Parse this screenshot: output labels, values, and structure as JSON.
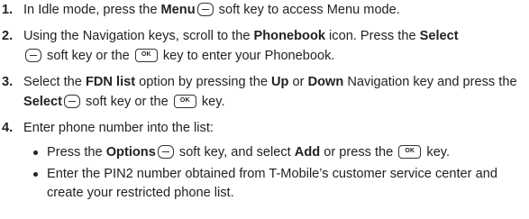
{
  "steps": [
    {
      "number": "1.",
      "t1": "In Idle mode, press the ",
      "b1": "Menu",
      "t2": " soft key to access Menu mode."
    },
    {
      "number": "2.",
      "t1": "Using the Navigation keys, scroll to the ",
      "b1": "Phonebook",
      "t2": " icon. Press the ",
      "b2": "Select",
      "t3": " soft key or the ",
      "t4": " key to enter your Phonebook."
    },
    {
      "number": "3.",
      "t1": "Select the ",
      "b1": "FDN list",
      "t2": " option by pressing the ",
      "b2": "Up",
      "t3": " or ",
      "b3": "Down",
      "t4": " Navigation key and press the ",
      "b4": "Select",
      "t5": " soft key or the ",
      "t6": " key."
    },
    {
      "number": "4.",
      "t1": "Enter phone number into the list:"
    }
  ],
  "bullets": [
    {
      "t1": "Press the ",
      "b1": "Options",
      "t2": " soft key, and select ",
      "b2": "Add",
      "t3": " or press the ",
      "t4": " key."
    },
    {
      "t1": "Enter the PIN2 number obtained from T-Mobile’s customer service center and create your restricted phone list."
    }
  ],
  "icons": {
    "ok_key_label": "OK"
  }
}
